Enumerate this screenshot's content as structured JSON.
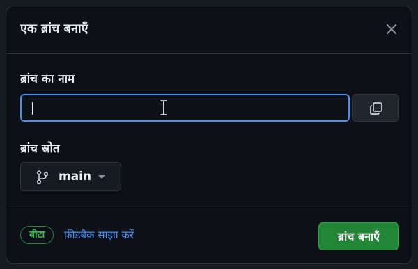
{
  "dialog": {
    "title": "एक ब्रांच बनाएँ",
    "close_icon": "x-icon"
  },
  "form": {
    "name_label": "ब्रांच का नाम",
    "name_value": "",
    "copy_icon": "copy-icon",
    "source_label": "ब्रांच स्रोत",
    "source_branch": "main",
    "branch_icon": "git-branch-icon",
    "dropdown_icon": "triangle-down-icon"
  },
  "footer": {
    "beta_label": "बीटा",
    "feedback_label": "फ़ीडबैक साझा करें",
    "create_label": "ब्रांच बनाएँ"
  },
  "colors": {
    "accent_blue": "#4493f8",
    "primary_green": "#238636",
    "beta_green": "#3fb950",
    "background": "#0d1117",
    "border": "#30363d"
  }
}
